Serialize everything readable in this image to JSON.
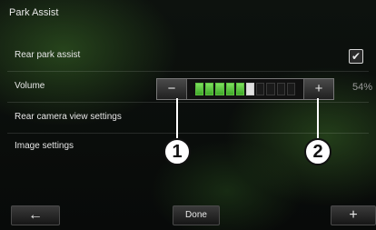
{
  "header": {
    "title": "Park Assist"
  },
  "settings": {
    "rear_park_assist": {
      "label": "Rear park assist",
      "checked": true,
      "check_glyph": "✔"
    },
    "volume": {
      "label": "Volume",
      "minus": "−",
      "plus": "+",
      "value_text": "54%",
      "level": 0.54,
      "segments": 10
    },
    "rear_camera": {
      "label": "Rear camera view settings"
    },
    "image": {
      "label": "Image settings"
    }
  },
  "callouts": [
    {
      "number": "1"
    },
    {
      "number": "2"
    }
  ],
  "bottom": {
    "back_glyph": "←",
    "done_label": "Done",
    "add_glyph": "+"
  },
  "colors": {
    "level_fill": "#5cbf3f"
  }
}
